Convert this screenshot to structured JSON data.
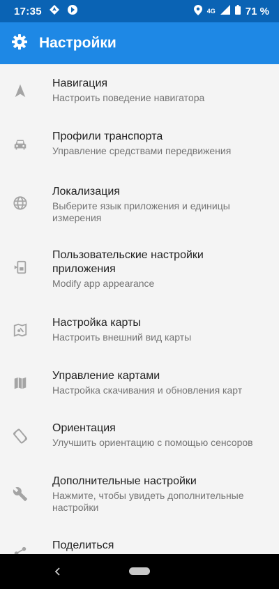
{
  "status_bar": {
    "time": "17:35",
    "network": "4G",
    "battery_percent": "71 %"
  },
  "app_bar": {
    "title": "Настройки",
    "icon": "gear-icon"
  },
  "items": [
    {
      "title": "Навигация",
      "subtitle": "Настроить поведение навигатора",
      "icon": "navigation-arrow-icon"
    },
    {
      "title": "Профили транспорта",
      "subtitle": "Управление средствами передвижения",
      "icon": "car-icon"
    },
    {
      "title": "Локализация",
      "subtitle": "Выберите язык приложения и единицы измерения",
      "icon": "globe-icon"
    },
    {
      "title": "Пользовательские настройки приложения",
      "subtitle": "Modify app appearance",
      "icon": "app-customize-icon"
    },
    {
      "title": "Настройка карты",
      "subtitle": "Настроить внешний вид карты",
      "icon": "map-style-icon"
    },
    {
      "title": "Управление картами",
      "subtitle": "Настройка скачивания и обновления карт",
      "icon": "map-icon"
    },
    {
      "title": "Ориентация",
      "subtitle": "Улучшить ориентацию с помощью сенсоров",
      "icon": "screen-rotation-icon"
    },
    {
      "title": "Дополнительные настройки",
      "subtitle": "Нажмите, чтобы увидеть дополнительные настройки",
      "icon": "wrench-icon"
    },
    {
      "title": "Поделиться",
      "subtitle": "",
      "icon": "share-icon"
    }
  ],
  "colors": {
    "status_bar": "#0a63b4",
    "app_bar": "#1e88e5",
    "background": "#f4f4f4",
    "icon": "#a4a4a4"
  }
}
